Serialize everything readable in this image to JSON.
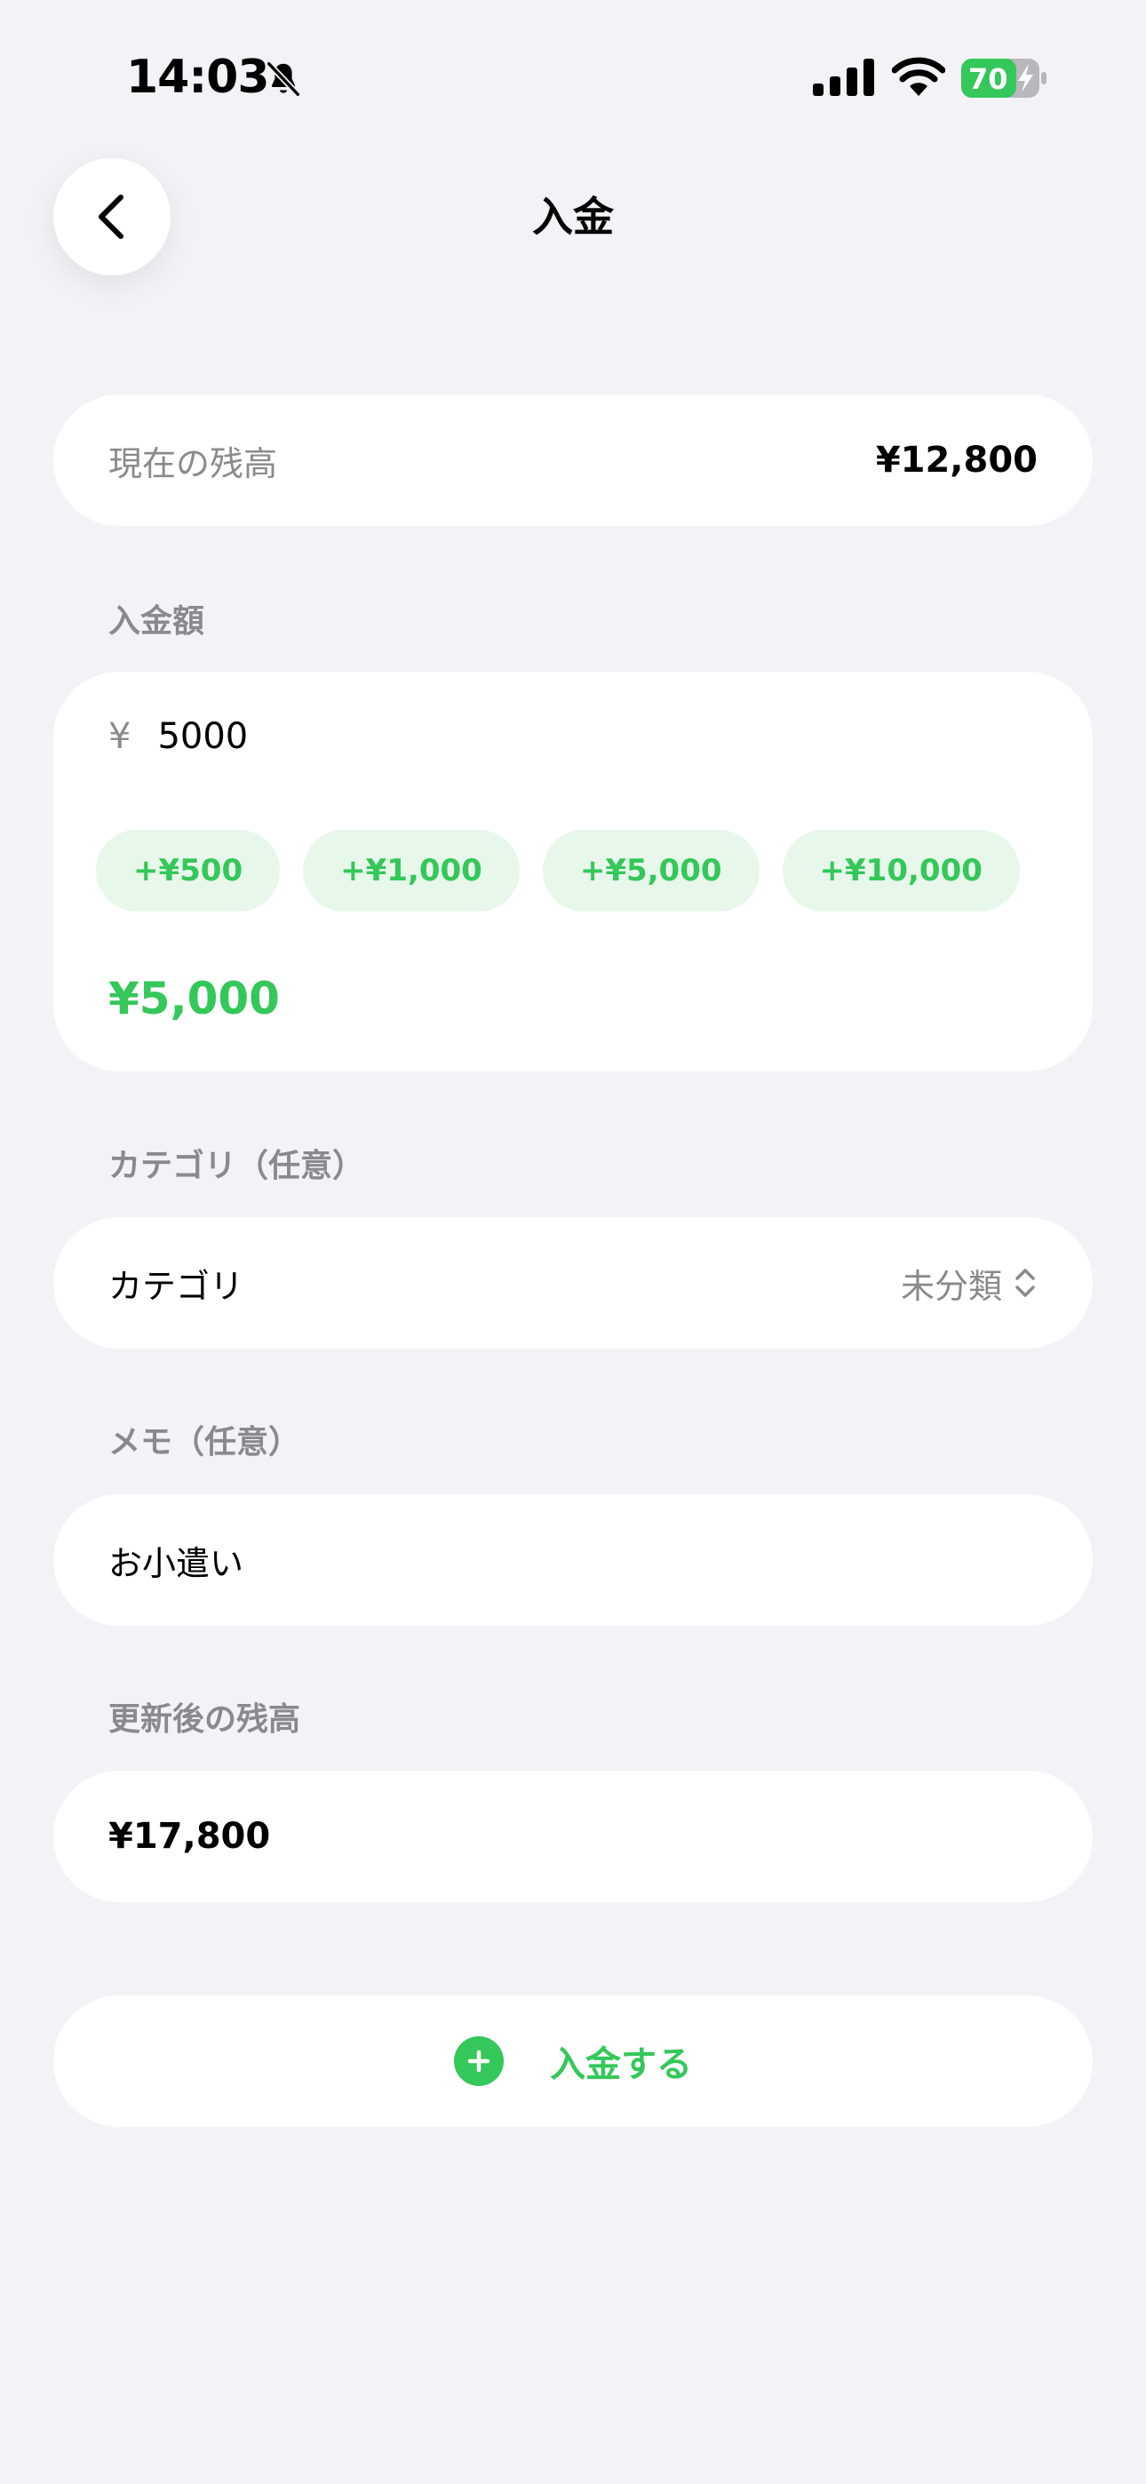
{
  "status_bar": {
    "time": "14:03",
    "battery_level": "70",
    "icons": [
      "bell-slash-icon",
      "cellular-signal-icon",
      "wifi-icon",
      "battery-charging-icon"
    ]
  },
  "header": {
    "title": "入金",
    "back_icon": "chevron-left-icon"
  },
  "current_balance": {
    "label": "現在の残高",
    "value": "¥12,800"
  },
  "amount": {
    "section_label": "入金額",
    "currency_symbol": "¥",
    "input_value": "5000",
    "quick_add": [
      "+¥500",
      "+¥1,000",
      "+¥5,000",
      "+¥10,000"
    ],
    "display": "¥5,000"
  },
  "category": {
    "section_label": "カテゴリ（任意）",
    "label": "カテゴリ",
    "selected": "未分類",
    "icon": "chevron-up-down-icon"
  },
  "memo": {
    "section_label": "メモ（任意）",
    "value": "お小遣い"
  },
  "updated_balance": {
    "section_label": "更新後の残高",
    "value": "¥17,800"
  },
  "submit": {
    "label": "入金する",
    "icon": "plus-circle-icon"
  },
  "colors": {
    "accent": "#34c759",
    "chip_bg": "#e7f7ea",
    "background": "#f2f2f7",
    "secondary_text": "#8a8a8e"
  }
}
